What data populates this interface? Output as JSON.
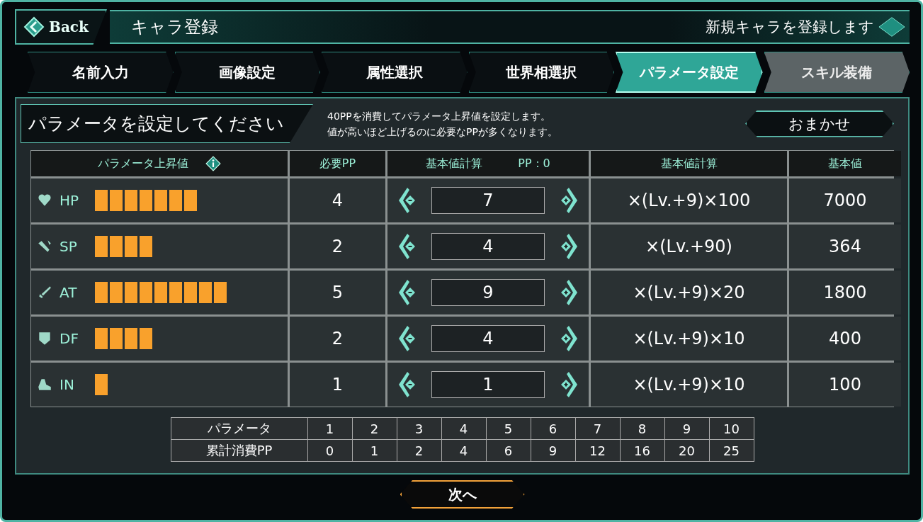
{
  "header": {
    "back": "Back",
    "title": "キャラ登録",
    "subtitle": "新規キャラを登録します"
  },
  "tabs": [
    {
      "label": "名前入力",
      "selected": false,
      "disabled": false
    },
    {
      "label": "画像設定",
      "selected": false,
      "disabled": false
    },
    {
      "label": "属性選択",
      "selected": false,
      "disabled": false
    },
    {
      "label": "世界相選択",
      "selected": false,
      "disabled": false
    },
    {
      "label": "パラメータ設定",
      "selected": true,
      "disabled": false
    },
    {
      "label": "スキル装備",
      "selected": false,
      "disabled": true
    }
  ],
  "panel": {
    "heading": "パラメータを設定してください",
    "description": [
      "40PPを消費してパラメータ上昇値を設定します。",
      "値が高いほど上げるのに必要なPPが多くなります。"
    ],
    "auto_button": "おまかせ"
  },
  "table": {
    "columns": [
      "パラメータ上昇値",
      "必要PP",
      "基本値計算",
      "PP：0",
      "基本値計算",
      "基本値"
    ],
    "rows": [
      {
        "kind": "heart",
        "stat": "HP",
        "cost": "4",
        "value": "7",
        "formula": "×(Lv.+9)×100",
        "base": "7000"
      },
      {
        "kind": "wand",
        "stat": "SP",
        "cost": "2",
        "value": "4",
        "formula": "×(Lv.+90)",
        "base": "364"
      },
      {
        "kind": "sword",
        "stat": "AT",
        "cost": "5",
        "value": "9",
        "formula": "×(Lv.+9)×20",
        "base": "1800"
      },
      {
        "kind": "shield",
        "stat": "DF",
        "cost": "2",
        "value": "4",
        "formula": "×(Lv.+9)×10",
        "base": "400"
      },
      {
        "kind": "boot",
        "stat": "IN",
        "cost": "1",
        "value": "1",
        "formula": "×(Lv.+9)×10",
        "base": "100"
      }
    ]
  },
  "cost_table": {
    "rows": [
      {
        "label": "パラメータ",
        "cells": [
          "1",
          "2",
          "3",
          "4",
          "5",
          "6",
          "7",
          "8",
          "9",
          "10"
        ]
      },
      {
        "label": "累計消費PP",
        "cells": [
          "0",
          "1",
          "2",
          "4",
          "6",
          "9",
          "12",
          "16",
          "20",
          "25"
        ]
      }
    ]
  },
  "next_button": "次へ"
}
